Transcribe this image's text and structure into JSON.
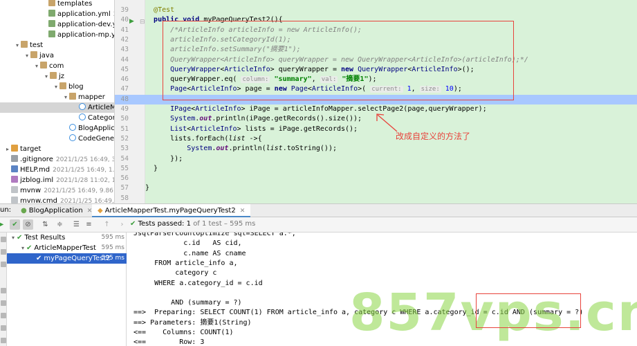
{
  "project_tree": [
    {
      "name": "templates",
      "meta": "",
      "icon": "folder-icon",
      "indent": 60,
      "arrow": ""
    },
    {
      "name": "application.yml",
      "meta": "2020/",
      "icon": "yml-icon",
      "indent": 60,
      "arrow": ""
    },
    {
      "name": "application-dev.yml",
      "meta": "",
      "icon": "yml-icon",
      "indent": 60,
      "arrow": ""
    },
    {
      "name": "application-mp.yml",
      "meta": "",
      "icon": "yml-icon",
      "indent": 60,
      "arrow": ""
    },
    {
      "name": "test",
      "meta": "",
      "icon": "folder-icon",
      "indent": 20,
      "arrow": "▾"
    },
    {
      "name": "java",
      "meta": "",
      "icon": "folder-icon",
      "indent": 34,
      "arrow": "▾"
    },
    {
      "name": "com",
      "meta": "",
      "icon": "folder-icon",
      "indent": 48,
      "arrow": "▾"
    },
    {
      "name": "jz",
      "meta": "",
      "icon": "folder-icon",
      "indent": 62,
      "arrow": "▾"
    },
    {
      "name": "blog",
      "meta": "",
      "icon": "folder-icon",
      "indent": 76,
      "arrow": "▾"
    },
    {
      "name": "mapper",
      "meta": "",
      "icon": "folder-icon",
      "indent": 90,
      "arrow": "▾"
    },
    {
      "name": "ArticleMa",
      "meta": "",
      "icon": "class-icon",
      "indent": 104,
      "arrow": "",
      "selected": true
    },
    {
      "name": "Category",
      "meta": "",
      "icon": "class-icon",
      "indent": 104,
      "arrow": ""
    },
    {
      "name": "BlogApplica",
      "meta": "",
      "icon": "class-icon",
      "indent": 90,
      "arrow": ""
    },
    {
      "name": "CodeGenera",
      "meta": "",
      "icon": "class-icon",
      "indent": 90,
      "arrow": ""
    },
    {
      "name": "target",
      "meta": "",
      "icon": "target-folder-icon",
      "indent": 6,
      "arrow": "▸"
    },
    {
      "name": ".gitignore",
      "meta": "2021/1/25 16:49, 395",
      "icon": "gitignore-icon",
      "indent": 6,
      "arrow": ""
    },
    {
      "name": "HELP.md",
      "meta": "2021/1/25 16:49, 1.18",
      "icon": "markdown-icon",
      "indent": 6,
      "arrow": ""
    },
    {
      "name": "jzblog.iml",
      "meta": "2021/1/28 11:02, 11.2",
      "icon": "iml-icon",
      "indent": 6,
      "arrow": ""
    },
    {
      "name": "mvnw",
      "meta": "2021/1/25 16:49, 9.86 k",
      "icon": "file-icon",
      "indent": 6,
      "arrow": ""
    },
    {
      "name": "mvnw.cmd",
      "meta": "2021/1/25 16:49, 6.6",
      "icon": "file-icon",
      "indent": 6,
      "arrow": ""
    }
  ],
  "editor": {
    "line_numbers": [
      "39",
      "40",
      "41",
      "42",
      "43",
      "44",
      "45",
      "46",
      "47",
      "48",
      "49",
      "50",
      "51",
      "52",
      "53",
      "54",
      "55",
      "56",
      "57",
      "58"
    ],
    "current_line_index": 9,
    "annotation_text": "改成自定义的方法了"
  },
  "run_panel": {
    "run_label": "un:",
    "tabs": [
      {
        "label": "BlogApplication",
        "active": false
      },
      {
        "label": "ArticleMapperTest.myPageQueryTest2",
        "active": true
      }
    ],
    "tests_passed": "Tests passed:",
    "tests_count": "1",
    "tests_of": "of 1 test – 595 ms"
  },
  "test_results": [
    {
      "label": "Test Results",
      "time": "595 ms",
      "indent": 4,
      "arrow": "▾",
      "selected": false
    },
    {
      "label": "ArticleMapperTest",
      "time": "595 ms",
      "indent": 18,
      "arrow": "▾",
      "selected": false
    },
    {
      "label": "myPageQueryTest2",
      "time": "595 ms",
      "indent": 32,
      "arrow": "",
      "selected": true
    }
  ],
  "console_lines": [
    "JsqlParserCountOptimize sql=SELECT a.*,",
    "            c.id   AS cid,",
    "            c.name AS cname",
    "     FROM article_info a,",
    "          category c",
    "     WHERE a.category_id = c.id",
    "",
    "         AND (summary = ?)",
    "==>  Preparing: SELECT COUNT(1) FROM article_info a, category c WHERE a.category_id = c.id AND (summary = ?)",
    "==> Parameters: 摘要1(String)",
    "<==    Columns: COUNT(1)",
    "<==        Row: 3"
  ],
  "watermark": "857vps.cn"
}
